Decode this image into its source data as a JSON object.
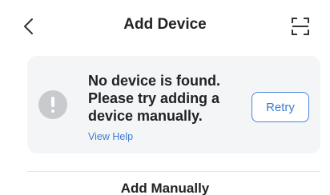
{
  "header": {
    "title": "Add Device",
    "back_icon": "chevron-left-icon",
    "scan_icon": "scan-icon"
  },
  "notice": {
    "icon": "alert-icon",
    "message": "No device is found. Please try adding a device manually.",
    "help_link": "View Help",
    "retry_label": "Retry"
  },
  "section": {
    "title": "Add Manually"
  },
  "colors": {
    "accent": "#3a7bd5",
    "card_bg": "#f4f5f7",
    "icon_gray": "#c9cacd",
    "text": "#222222"
  }
}
